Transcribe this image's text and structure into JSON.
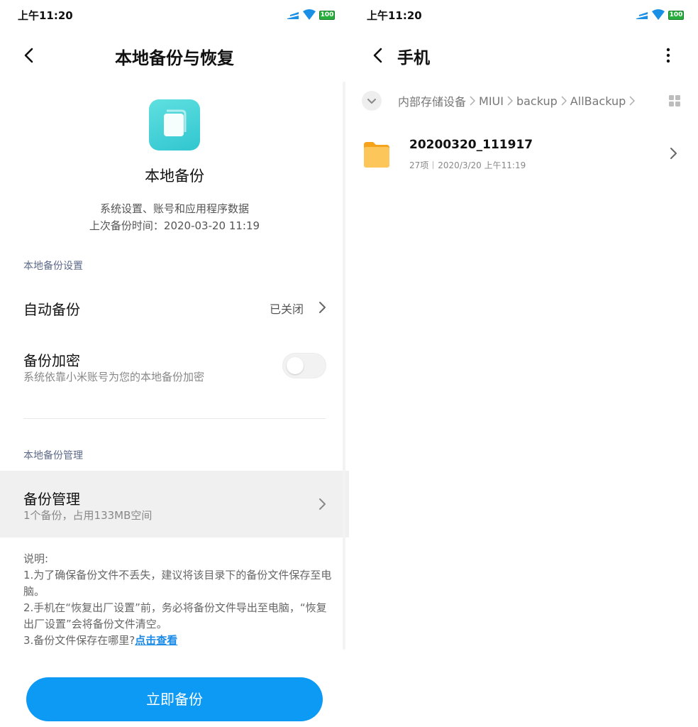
{
  "left": {
    "status": {
      "time": "上午11:20",
      "battery": "100"
    },
    "header": {
      "title": "本地备份与恢复"
    },
    "app": {
      "title": "本地备份",
      "desc_line1": "系统设置、账号和应用程序数据",
      "desc_line2": "上次备份时间：2020-03-20 11:19"
    },
    "settings_section": "本地备份设置",
    "auto_backup": {
      "label": "自动备份",
      "status": "已关闭"
    },
    "encryption": {
      "label": "备份加密",
      "sub": "系统依靠小米账号为您的本地备份加密",
      "enabled": false
    },
    "management_section": "本地备份管理",
    "management": {
      "label": "备份管理",
      "sub": "1个备份，占用133MB空间"
    },
    "notes": {
      "heading": "说明:",
      "line1": "1.为了确保备份文件不丢失，建议将该目录下的备份文件保存至电脑。",
      "line2": "2.手机在“恢复出厂设置”前，务必将备份文件导出至电脑，“恢复出厂设置”会将备份文件清空。",
      "line3_prefix": "3.备份文件保存在哪里?",
      "line3_link": "点击查看"
    },
    "primary_button": "立即备份"
  },
  "right": {
    "status": {
      "time": "上午11:20",
      "battery": "100"
    },
    "header": {
      "title": "手机"
    },
    "breadcrumb": [
      "内部存储设备",
      "MIUI",
      "backup",
      "AllBackup"
    ],
    "folder": {
      "name": "20200320_111917",
      "count": "27项",
      "date": "2020/3/20 上午11:19"
    }
  },
  "colors": {
    "accent": "#0d9af5",
    "link": "#1a8be6",
    "section": "#5d6a8a",
    "battery": "#27ae3c",
    "folder": "#fbbf4a"
  }
}
